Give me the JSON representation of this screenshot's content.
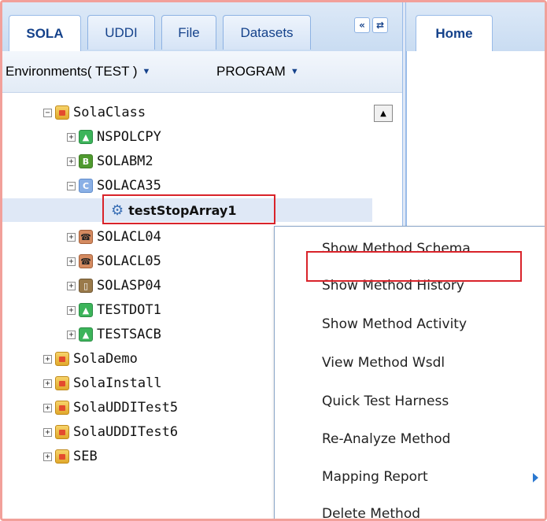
{
  "left_tabs": [
    "SOLA",
    "UDDI",
    "File",
    "Datasets"
  ],
  "left_tools": {
    "collapse": "«",
    "refresh": "⇄"
  },
  "right_tabs": [
    "Home"
  ],
  "env_bar": {
    "environment": "Environments( TEST )",
    "program": "PROGRAM"
  },
  "tree": [
    {
      "label": "SolaClass",
      "icon": "folder-icon",
      "expanded": true
    },
    {
      "label": "NSPOLCPY",
      "icon": "green-arrow-icon"
    },
    {
      "label": "SOLABM2",
      "icon": "b-icon",
      "glyph": "B"
    },
    {
      "label": "SOLACA35",
      "icon": "c-icon",
      "glyph": "C",
      "expanded": true
    },
    {
      "label": "testStopArray1",
      "icon": "gear-icon",
      "selected": true
    },
    {
      "label": "SOLACL04",
      "icon": "phone-icon"
    },
    {
      "label": "SOLACL05",
      "icon": "phone-icon"
    },
    {
      "label": "SOLASP04",
      "icon": "clipboard-icon"
    },
    {
      "label": "TESTDOT1",
      "icon": "green-arrow-icon"
    },
    {
      "label": "TESTSACB",
      "icon": "green-arrow-icon"
    },
    {
      "label": "SolaDemo",
      "icon": "folder-icon"
    },
    {
      "label": "SolaInstall",
      "icon": "folder-icon"
    },
    {
      "label": "SolaUDDITest5",
      "icon": "folder-icon"
    },
    {
      "label": "SolaUDDITest6",
      "icon": "folder-icon"
    },
    {
      "label": "SEB",
      "icon": "folder-icon"
    }
  ],
  "context_menu": [
    {
      "label": "Show Method Schema"
    },
    {
      "label": "Show Method History",
      "highlighted": true
    },
    {
      "label": "Show Method Activity"
    },
    {
      "label": "View Method Wsdl"
    },
    {
      "label": "Quick Test Harness"
    },
    {
      "label": "Re-Analyze Method"
    },
    {
      "label": "Mapping Report",
      "has_submenu": true
    },
    {
      "label": "Delete Method"
    }
  ],
  "colors": {
    "highlight": "#d9232a",
    "tab_text": "#15428b",
    "frame": "#f2a09a"
  }
}
